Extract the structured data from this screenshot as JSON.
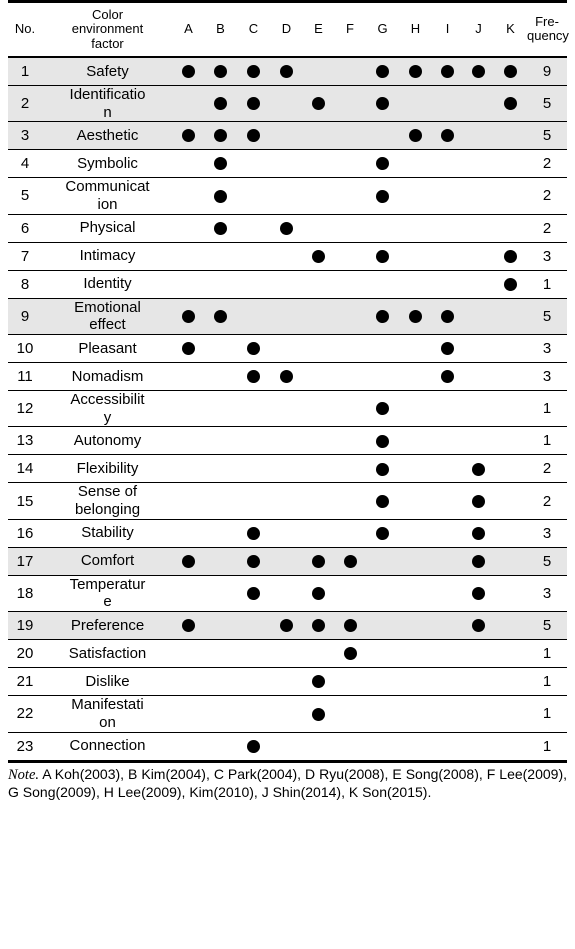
{
  "table": {
    "columns": {
      "no_label": "No.",
      "factor_label_line1": "Color",
      "factor_label_line2": "environment",
      "factor_label_line3": "factor",
      "source_letters": [
        "A",
        "B",
        "C",
        "D",
        "E",
        "F",
        "G",
        "H",
        "I",
        "J",
        "K"
      ],
      "frequency_label_line1": "Fre-",
      "frequency_label_line2": "quency"
    },
    "dot_glyph": "●",
    "shade_color": "#e6e6e6",
    "rows": [
      {
        "no": "1",
        "factor": "Safety",
        "factor_l1": "Safety",
        "factor_l2": "",
        "marks": [
          "A",
          "B",
          "C",
          "D",
          "G",
          "H",
          "I",
          "J",
          "K"
        ],
        "frequency": "9",
        "shaded": true
      },
      {
        "no": "2",
        "factor": "Identification",
        "factor_l1": "Identificatio",
        "factor_l2": "n",
        "marks": [
          "B",
          "C",
          "E",
          "G",
          "K"
        ],
        "frequency": "5",
        "shaded": true
      },
      {
        "no": "3",
        "factor": "Aesthetic",
        "factor_l1": "Aesthetic",
        "factor_l2": "",
        "marks": [
          "A",
          "B",
          "C",
          "H",
          "I"
        ],
        "frequency": "5",
        "shaded": true
      },
      {
        "no": "4",
        "factor": "Symbolic",
        "factor_l1": "Symbolic",
        "factor_l2": "",
        "marks": [
          "B",
          "G"
        ],
        "frequency": "2",
        "shaded": false
      },
      {
        "no": "5",
        "factor": "Communication",
        "factor_l1": "Communicat",
        "factor_l2": "ion",
        "marks": [
          "B",
          "G"
        ],
        "frequency": "2",
        "shaded": false
      },
      {
        "no": "6",
        "factor": "Physical",
        "factor_l1": "Physical",
        "factor_l2": "",
        "marks": [
          "B",
          "D"
        ],
        "frequency": "2",
        "shaded": false
      },
      {
        "no": "7",
        "factor": "Intimacy",
        "factor_l1": "Intimacy",
        "factor_l2": "",
        "marks": [
          "E",
          "G",
          "K"
        ],
        "frequency": "3",
        "shaded": false
      },
      {
        "no": "8",
        "factor": "Identity",
        "factor_l1": "Identity",
        "factor_l2": "",
        "marks": [
          "K"
        ],
        "frequency": "1",
        "shaded": false
      },
      {
        "no": "9",
        "factor": "Emotional effect",
        "factor_l1": "Emotional",
        "factor_l2": "effect",
        "marks": [
          "A",
          "B",
          "G",
          "H",
          "I"
        ],
        "frequency": "5",
        "shaded": true
      },
      {
        "no": "10",
        "factor": "Pleasant",
        "factor_l1": "Pleasant",
        "factor_l2": "",
        "marks": [
          "A",
          "C",
          "I"
        ],
        "frequency": "3",
        "shaded": false
      },
      {
        "no": "11",
        "factor": "Nomadism",
        "factor_l1": "Nomadism",
        "factor_l2": "",
        "marks": [
          "C",
          "D",
          "I"
        ],
        "frequency": "3",
        "shaded": false
      },
      {
        "no": "12",
        "factor": "Accessibility",
        "factor_l1": "Accessibilit",
        "factor_l2": "y",
        "marks": [
          "G"
        ],
        "frequency": "1",
        "shaded": false
      },
      {
        "no": "13",
        "factor": "Autonomy",
        "factor_l1": "Autonomy",
        "factor_l2": "",
        "marks": [
          "G"
        ],
        "frequency": "1",
        "shaded": false
      },
      {
        "no": "14",
        "factor": "Flexibility",
        "factor_l1": "Flexibility",
        "factor_l2": "",
        "marks": [
          "G",
          "J"
        ],
        "frequency": "2",
        "shaded": false
      },
      {
        "no": "15",
        "factor": "Sense of belonging",
        "factor_l1": "Sense of",
        "factor_l2": "belonging",
        "marks": [
          "G",
          "J"
        ],
        "frequency": "2",
        "shaded": false
      },
      {
        "no": "16",
        "factor": "Stability",
        "factor_l1": "Stability",
        "factor_l2": "",
        "marks": [
          "C",
          "G",
          "J"
        ],
        "frequency": "3",
        "shaded": false
      },
      {
        "no": "17",
        "factor": "Comfort",
        "factor_l1": "Comfort",
        "factor_l2": "",
        "marks": [
          "A",
          "C",
          "E",
          "F",
          "J"
        ],
        "frequency": "5",
        "shaded": true
      },
      {
        "no": "18",
        "factor": "Temperature",
        "factor_l1": "Temperatur",
        "factor_l2": "e",
        "marks": [
          "C",
          "E",
          "J"
        ],
        "frequency": "3",
        "shaded": false
      },
      {
        "no": "19",
        "factor": "Preference",
        "factor_l1": "Preference",
        "factor_l2": "",
        "marks": [
          "A",
          "D",
          "E",
          "F",
          "J"
        ],
        "frequency": "5",
        "shaded": true
      },
      {
        "no": "20",
        "factor": "Satisfaction",
        "factor_l1": "Satisfaction",
        "factor_l2": "",
        "marks": [
          "F"
        ],
        "frequency": "1",
        "shaded": false
      },
      {
        "no": "21",
        "factor": "Dislike",
        "factor_l1": "Dislike",
        "factor_l2": "",
        "marks": [
          "E"
        ],
        "frequency": "1",
        "shaded": false
      },
      {
        "no": "22",
        "factor": "Manifestation",
        "factor_l1": "Manifestati",
        "factor_l2": "on",
        "marks": [
          "E"
        ],
        "frequency": "1",
        "shaded": false
      },
      {
        "no": "23",
        "factor": "Connection",
        "factor_l1": "Connection",
        "factor_l2": "",
        "marks": [
          "C"
        ],
        "frequency": "1",
        "shaded": false
      }
    ]
  },
  "note": {
    "label": "Note.",
    "text": " A Koh(2003), B Kim(2004), C Park(2004), D Ryu(2008), E Song(2008), F Lee(2009), G Song(2009), H Lee(2009), Kim(2010), J Shin(2014), K Son(2015)."
  }
}
